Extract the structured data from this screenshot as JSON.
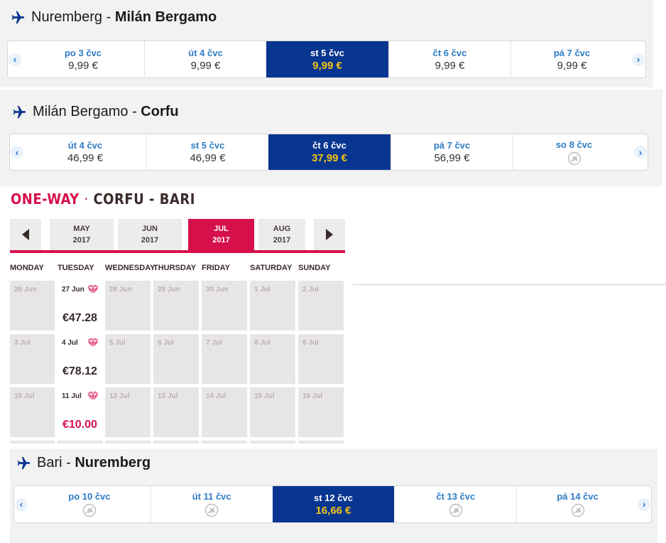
{
  "flights": [
    {
      "from": "Nuremberg",
      "to": "Milán Bergamo",
      "days": [
        {
          "label": "po 3 čvc",
          "price": "9,99 €"
        },
        {
          "label": "út 4 čvc",
          "price": "9,99 €"
        },
        {
          "label": "st 5 čvc",
          "price": "9,99 €",
          "selected": true
        },
        {
          "label": "čt 6 čvc",
          "price": "9,99 €"
        },
        {
          "label": "pá 7 čvc",
          "price": "9,99 €"
        }
      ]
    },
    {
      "from": "Milán Bergamo",
      "to": "Corfu",
      "days": [
        {
          "label": "út 4 čvc",
          "price": "46,99 €"
        },
        {
          "label": "st 5 čvc",
          "price": "46,99 €"
        },
        {
          "label": "čt 6 čvc",
          "price": "37,99 €",
          "selected": true
        },
        {
          "label": "pá 7 čvc",
          "price": "56,99 €"
        },
        {
          "label": "so 8 čvc",
          "price": null,
          "icon": "no-flight-icon"
        }
      ]
    },
    {
      "from": "Bari",
      "to": "Nuremberg",
      "days": [
        {
          "label": "po 10 čvc",
          "price": null,
          "icon": "no-flight-icon"
        },
        {
          "label": "út 11 čvc",
          "price": null,
          "icon": "no-flight-icon"
        },
        {
          "label": "st 12 čvc",
          "price": "16,66 €",
          "selected": true
        },
        {
          "label": "čt 13 čvc",
          "price": null,
          "icon": "no-flight-icon"
        },
        {
          "label": "pá 14 čvc",
          "price": null,
          "icon": "no-flight-icon"
        }
      ]
    }
  ],
  "nav": {
    "prev": "‹",
    "next": "›"
  },
  "oneway": {
    "title_a": "ONE-WAY",
    "title_sep": "·",
    "title_b": "CORFU - BARI",
    "months": [
      {
        "m": "MAY",
        "y": "2017"
      },
      {
        "m": "JUN",
        "y": "2017"
      },
      {
        "m": "JUL",
        "y": "2017",
        "active": true
      },
      {
        "m": "AUG",
        "y": "2017"
      }
    ],
    "weekdays": [
      "MONDAY",
      "TUESDAY",
      "WEDNESDAY",
      "THURSDAY",
      "FRIDAY",
      "SATURDAY",
      "SUNDAY"
    ],
    "weeks": [
      [
        {
          "d": "26 Jun"
        },
        {
          "d": "27 Jun",
          "price": "€47.28",
          "gem": true
        },
        {
          "d": "28 Jun"
        },
        {
          "d": "29 Jun"
        },
        {
          "d": "30 Jun"
        },
        {
          "d": "1 Jul"
        },
        {
          "d": "2 Jul"
        }
      ],
      [
        {
          "d": "3 Jul"
        },
        {
          "d": "4 Jul",
          "price": "€78.12",
          "gem": true
        },
        {
          "d": "5 Jul"
        },
        {
          "d": "6 Jul"
        },
        {
          "d": "7 Jul"
        },
        {
          "d": "8 Jul"
        },
        {
          "d": "9 Jul"
        }
      ],
      [
        {
          "d": "10 Jul"
        },
        {
          "d": "11 Jul",
          "price": "€10.00",
          "gem": true,
          "hot": true
        },
        {
          "d": "12 Jul"
        },
        {
          "d": "13 Jul"
        },
        {
          "d": "14 Jul"
        },
        {
          "d": "15 Jul"
        },
        {
          "d": "16 Jul"
        }
      ]
    ]
  },
  "colors": {
    "ryanair_blue": "#073590",
    "price_yellow": "#f5c414",
    "link_blue": "#2e7cc4",
    "volotea_pink": "#d6104b"
  }
}
